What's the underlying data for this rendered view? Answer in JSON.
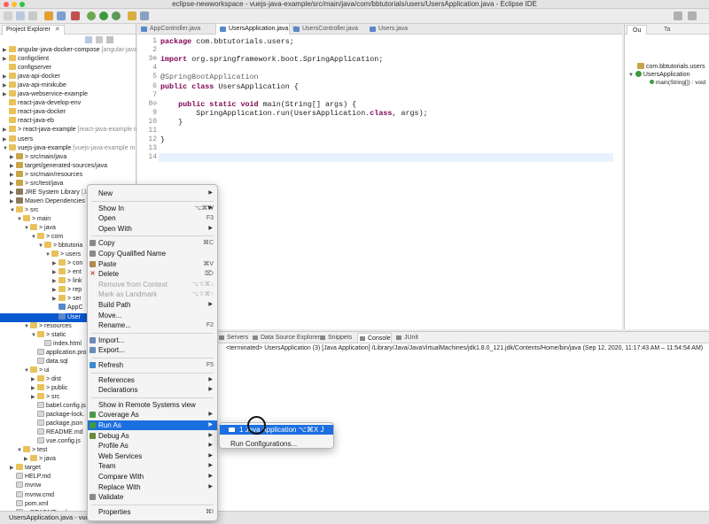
{
  "window": {
    "title": "eclipse-newworkspace - vuejs-java-example/src/main/java/com/bbtutorials/users/UsersApplication.java - Eclipse IDE"
  },
  "project_explorer": {
    "tab_label": "Project Explorer",
    "rows": [
      {
        "indent": 0,
        "arrow": "▶",
        "icon": "folder",
        "label": "angular-java-docker-compose",
        "muted": " [angular-java"
      },
      {
        "indent": 0,
        "arrow": "▶",
        "icon": "folder",
        "label": "configclient",
        "muted": ""
      },
      {
        "indent": 0,
        "arrow": "",
        "icon": "folder",
        "label": "configserver",
        "muted": ""
      },
      {
        "indent": 0,
        "arrow": "▶",
        "icon": "folder",
        "label": "java-api-docker",
        "muted": ""
      },
      {
        "indent": 0,
        "arrow": "▶",
        "icon": "folder",
        "label": "java-api-minikube",
        "muted": ""
      },
      {
        "indent": 0,
        "arrow": "▶",
        "icon": "folder",
        "label": "java-webservice-example",
        "muted": ""
      },
      {
        "indent": 0,
        "arrow": "",
        "icon": "folder",
        "label": "react-java-develop-env",
        "muted": ""
      },
      {
        "indent": 0,
        "arrow": "",
        "icon": "folder",
        "label": "react-java-docker",
        "muted": ""
      },
      {
        "indent": 0,
        "arrow": "",
        "icon": "folder",
        "label": "react-java-eb",
        "muted": ""
      },
      {
        "indent": 0,
        "arrow": "▶",
        "icon": "folder",
        "label": "> react-java-example",
        "muted": " [react-java-example m"
      },
      {
        "indent": 0,
        "arrow": "▶",
        "icon": "folder",
        "label": "users",
        "muted": ""
      },
      {
        "indent": 0,
        "arrow": "▼",
        "icon": "folder",
        "label": "vuejs-java-example",
        "muted": " [vuejs-java-example m"
      },
      {
        "indent": 1,
        "arrow": "▶",
        "icon": "pkg",
        "label": "> src/main/java",
        "muted": ""
      },
      {
        "indent": 1,
        "arrow": "▶",
        "icon": "pkg",
        "label": "target/generated-sources/java",
        "muted": ""
      },
      {
        "indent": 1,
        "arrow": "▶",
        "icon": "pkg",
        "label": "> src/main/resources",
        "muted": ""
      },
      {
        "indent": 1,
        "arrow": "▶",
        "icon": "pkg",
        "label": "> src/test/java",
        "muted": ""
      },
      {
        "indent": 1,
        "arrow": "▶",
        "icon": "jar",
        "label": "JRE System Library",
        "muted": " [Ja"
      },
      {
        "indent": 1,
        "arrow": "▶",
        "icon": "jar",
        "label": "Maven Dependencies",
        "muted": ""
      },
      {
        "indent": 1,
        "arrow": "▼",
        "icon": "folder",
        "label": "> src",
        "muted": ""
      },
      {
        "indent": 2,
        "arrow": "▼",
        "icon": "folder",
        "label": "> main",
        "muted": ""
      },
      {
        "indent": 3,
        "arrow": "▼",
        "icon": "folder",
        "label": "> java",
        "muted": ""
      },
      {
        "indent": 4,
        "arrow": "▼",
        "icon": "folder",
        "label": "> com",
        "muted": ""
      },
      {
        "indent": 5,
        "arrow": "▼",
        "icon": "folder",
        "label": "> bbtutoria",
        "muted": ""
      },
      {
        "indent": 6,
        "arrow": "▼",
        "icon": "folder",
        "label": "> users",
        "muted": ""
      },
      {
        "indent": 7,
        "arrow": "▶",
        "icon": "folder",
        "label": "> con",
        "muted": ""
      },
      {
        "indent": 7,
        "arrow": "▶",
        "icon": "folder",
        "label": "> ent",
        "muted": ""
      },
      {
        "indent": 7,
        "arrow": "▶",
        "icon": "folder",
        "label": "> link",
        "muted": ""
      },
      {
        "indent": 7,
        "arrow": "▶",
        "icon": "folder",
        "label": "> rep",
        "muted": ""
      },
      {
        "indent": 7,
        "arrow": "▶",
        "icon": "folder",
        "label": "> ser",
        "muted": ""
      },
      {
        "indent": 7,
        "arrow": "",
        "icon": "java",
        "label": "AppC",
        "muted": ""
      },
      {
        "indent": 7,
        "arrow": "",
        "icon": "java",
        "label": "User",
        "muted": "",
        "selected": true
      },
      {
        "indent": 3,
        "arrow": "▼",
        "icon": "folder",
        "label": "> resources",
        "muted": ""
      },
      {
        "indent": 4,
        "arrow": "▼",
        "icon": "folder",
        "label": "> static",
        "muted": ""
      },
      {
        "indent": 5,
        "arrow": "",
        "icon": "file",
        "label": "index.html",
        "muted": ""
      },
      {
        "indent": 4,
        "arrow": "",
        "icon": "file",
        "label": "application.pro",
        "muted": ""
      },
      {
        "indent": 4,
        "arrow": "",
        "icon": "file",
        "label": "data.sql",
        "muted": ""
      },
      {
        "indent": 3,
        "arrow": "▼",
        "icon": "folder",
        "label": "> ui",
        "muted": ""
      },
      {
        "indent": 4,
        "arrow": "▶",
        "icon": "folder",
        "label": "> dist",
        "muted": ""
      },
      {
        "indent": 4,
        "arrow": "▶",
        "icon": "folder",
        "label": "> public",
        "muted": ""
      },
      {
        "indent": 4,
        "arrow": "▶",
        "icon": "folder",
        "label": "> src",
        "muted": ""
      },
      {
        "indent": 4,
        "arrow": "",
        "icon": "file",
        "label": "babel.config.js",
        "muted": ""
      },
      {
        "indent": 4,
        "arrow": "",
        "icon": "file",
        "label": "package-lock.",
        "muted": ""
      },
      {
        "indent": 4,
        "arrow": "",
        "icon": "file",
        "label": "package.json",
        "muted": ""
      },
      {
        "indent": 4,
        "arrow": "",
        "icon": "file",
        "label": "README.md",
        "muted": ""
      },
      {
        "indent": 4,
        "arrow": "",
        "icon": "file",
        "label": "vue.config.js",
        "muted": ""
      },
      {
        "indent": 2,
        "arrow": "▼",
        "icon": "folder",
        "label": "> test",
        "muted": ""
      },
      {
        "indent": 3,
        "arrow": "▶",
        "icon": "folder",
        "label": "> java",
        "muted": ""
      },
      {
        "indent": 1,
        "arrow": "▶",
        "icon": "folder",
        "label": "target",
        "muted": ""
      },
      {
        "indent": 1,
        "arrow": "",
        "icon": "file",
        "label": "HELP.md",
        "muted": ""
      },
      {
        "indent": 1,
        "arrow": "",
        "icon": "file",
        "label": "mvnw",
        "muted": ""
      },
      {
        "indent": 1,
        "arrow": "",
        "icon": "file",
        "label": "mvnw.cmd",
        "muted": ""
      },
      {
        "indent": 1,
        "arrow": "",
        "icon": "file",
        "label": "pom.xml",
        "muted": ""
      },
      {
        "indent": 1,
        "arrow": "",
        "icon": "file",
        "label": "> README.md",
        "muted": ""
      }
    ]
  },
  "editor": {
    "tabs": [
      "AppController.java",
      "UsersApplication.java",
      "UsersController.java",
      "Users.java"
    ],
    "lines": [
      "package com.bbtutorials.users;",
      "",
      "import org.springframework.boot.SpringApplication;",
      "",
      "@SpringBootApplication",
      "public class UsersApplication {",
      "",
      "    public static void main(String[] args) {",
      "        SpringApplication.run(UsersApplication.class, args);",
      "    }",
      "",
      "}",
      "",
      ""
    ],
    "line_numbers": [
      "1",
      "2",
      "3⊕",
      "4",
      "5",
      "6",
      "7",
      "8⊖",
      "9",
      "10",
      "11",
      "12",
      "13",
      "14"
    ]
  },
  "outline": {
    "tabs": [
      "Ou",
      "Ta"
    ],
    "rows": [
      "com.bbtutorials.users",
      "UsersApplication",
      "main(String[]) : void"
    ]
  },
  "console": {
    "tabs": [
      "Servers",
      "Data Source Explorer",
      "Snippets",
      "Console",
      "JUnit"
    ],
    "text": "<terminated> UsersApplication (3) [Java Application] /Library/Java/JavaVirtualMachines/jdk1.8.0_121.jdk/Contents/Home/bin/java  (Sep 12, 2020, 11:17:43 AM – 11:54:54 AM)"
  },
  "status": {
    "text": "UsersApplication.java - vuejs-java-example/src/main/java"
  },
  "context_menu": {
    "items": [
      {
        "label": "New",
        "shortcut": "",
        "sub": true
      },
      {
        "sep": true
      },
      {
        "label": "Show In",
        "shortcut": "⌥⌘W",
        "sub": true
      },
      {
        "label": "Open",
        "shortcut": "F3"
      },
      {
        "label": "Open With",
        "shortcut": "",
        "sub": true
      },
      {
        "sep": true
      },
      {
        "label": "Copy",
        "shortcut": "⌘C",
        "icon": "copy"
      },
      {
        "label": "Copy Qualified Name",
        "shortcut": "",
        "icon": "copy"
      },
      {
        "label": "Paste",
        "shortcut": "⌘V",
        "icon": "paste"
      },
      {
        "label": "Delete",
        "shortcut": "⌦",
        "icon": "delete"
      },
      {
        "label": "Remove from Context",
        "shortcut": "⌥⇧⌘↓",
        "disabled": true
      },
      {
        "label": "Mark as Landmark",
        "shortcut": "⌥⇧⌘↑",
        "disabled": true
      },
      {
        "label": "Build Path",
        "shortcut": "",
        "sub": true
      },
      {
        "label": "Move...",
        "shortcut": ""
      },
      {
        "label": "Rename...",
        "shortcut": "F2"
      },
      {
        "sep": true
      },
      {
        "label": "Import...",
        "shortcut": "",
        "icon": "import"
      },
      {
        "label": "Export...",
        "shortcut": "",
        "icon": "export"
      },
      {
        "sep": true
      },
      {
        "label": "Refresh",
        "shortcut": "F5",
        "icon": "refresh"
      },
      {
        "sep": true
      },
      {
        "label": "References",
        "shortcut": "",
        "sub": true
      },
      {
        "label": "Declarations",
        "shortcut": "",
        "sub": true
      },
      {
        "sep": true
      },
      {
        "label": "Show in Remote Systems view",
        "shortcut": ""
      },
      {
        "label": "Coverage As",
        "shortcut": "",
        "sub": true,
        "icon": "coverage"
      },
      {
        "label": "Run As",
        "shortcut": "",
        "sub": true,
        "icon": "run",
        "highlighted": true
      },
      {
        "label": "Debug As",
        "shortcut": "",
        "sub": true,
        "icon": "debug"
      },
      {
        "label": "Profile As",
        "shortcut": "",
        "sub": true
      },
      {
        "label": "Web Services",
        "shortcut": "",
        "sub": true
      },
      {
        "label": "Team",
        "shortcut": "",
        "sub": true
      },
      {
        "label": "Compare With",
        "shortcut": "",
        "sub": true
      },
      {
        "label": "Replace With",
        "shortcut": "",
        "sub": true
      },
      {
        "label": "Validate",
        "shortcut": "",
        "icon": "validate"
      },
      {
        "sep": true
      },
      {
        "label": "Properties",
        "shortcut": "⌘I"
      }
    ]
  },
  "submenu": {
    "items": [
      {
        "label": "1 Java Application  ⌥⌘X J",
        "highlighted": true
      },
      {
        "label": "Run Configurations...",
        "highlighted": false
      }
    ]
  },
  "colors": {
    "accent": "#1b6fe0",
    "selection": "#0a58d0",
    "keyword": "#7f0055"
  }
}
